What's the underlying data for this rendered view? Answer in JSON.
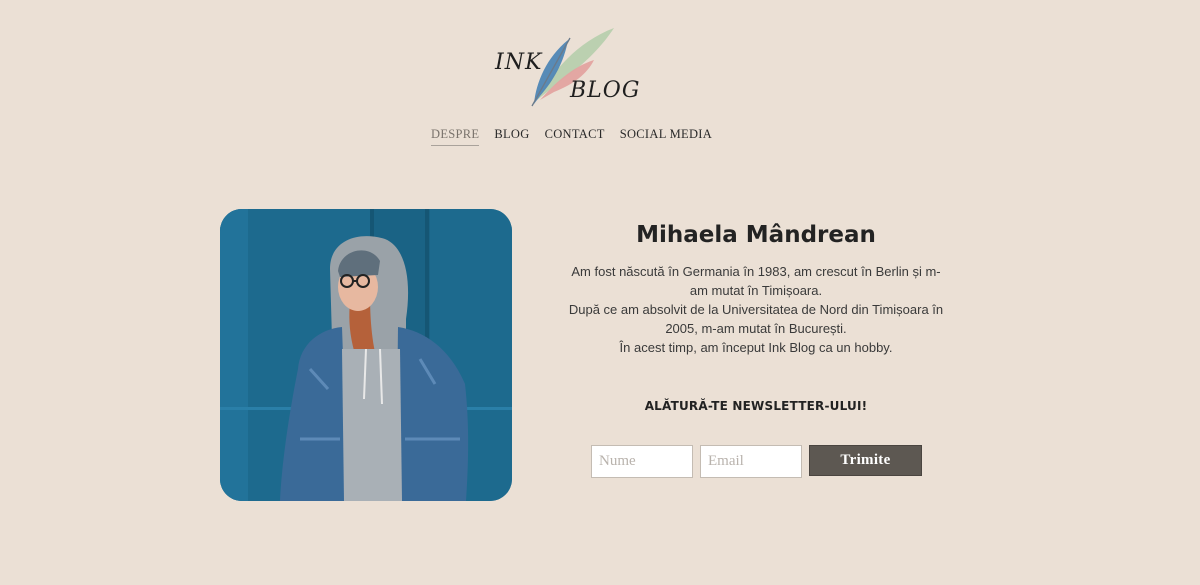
{
  "logo": {
    "word1": "INK",
    "word2": "BLOG"
  },
  "nav": {
    "items": [
      {
        "label": "DESPRE"
      },
      {
        "label": "BLOG"
      },
      {
        "label": "CONTACT"
      },
      {
        "label": "SOCIAL MEDIA"
      }
    ]
  },
  "profile": {
    "name": "Mihaela Mândrean",
    "bio_lines": [
      "Am fost născută în Germania în 1983, am crescut în Berlin și m-am mutat în Timișoara.",
      "După ce am absolvit de la Universitatea de Nord din Timișoara în 2005, m-am mutat în București.",
      "În acest timp, am început Ink Blog ca un hobby."
    ]
  },
  "newsletter": {
    "title": "ALĂTURĂ-TE NEWSLETTER-ULUI!",
    "name_placeholder": "Nume",
    "email_placeholder": "Email",
    "submit_label": "Trimite"
  },
  "colors": {
    "background": "#ebe0d5",
    "button": "#5d5852",
    "photo_blue": "#1f6b8f"
  }
}
